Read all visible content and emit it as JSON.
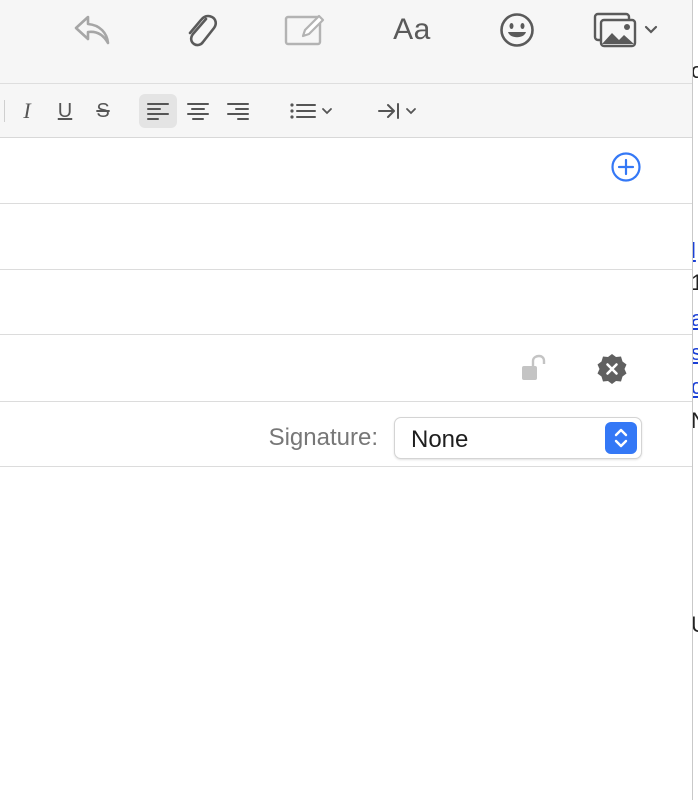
{
  "toolbar": {
    "icons": [
      "reply-icon",
      "paperclip-icon",
      "markup-icon",
      "format-text-icon",
      "emoji-icon",
      "photo-browser-icon",
      "chevron-down-icon"
    ],
    "format_label": "Aa"
  },
  "formatbar": {
    "italic_label": "I",
    "underline_label": "U",
    "strikethrough_label": "S",
    "icons": [
      "align-left-icon",
      "align-center-icon",
      "align-right-icon",
      "bullet-list-icon",
      "indent-icon"
    ],
    "active_alignment": "left"
  },
  "header_fields": {
    "to_add_icon": "plus-circle-icon",
    "security_icons": [
      "unlock-icon",
      "sign-badge-icon"
    ]
  },
  "signature": {
    "label": "Signature:",
    "value": "None"
  },
  "edge_text": [
    "o",
    "1",
    "N",
    "U"
  ],
  "edge_link_text": [
    "l",
    "a",
    "s",
    "c"
  ],
  "colors": {
    "accent": "#3478f6",
    "toolbar_bg": "#f6f6f6",
    "icon_gray": "#5a5a5a"
  }
}
